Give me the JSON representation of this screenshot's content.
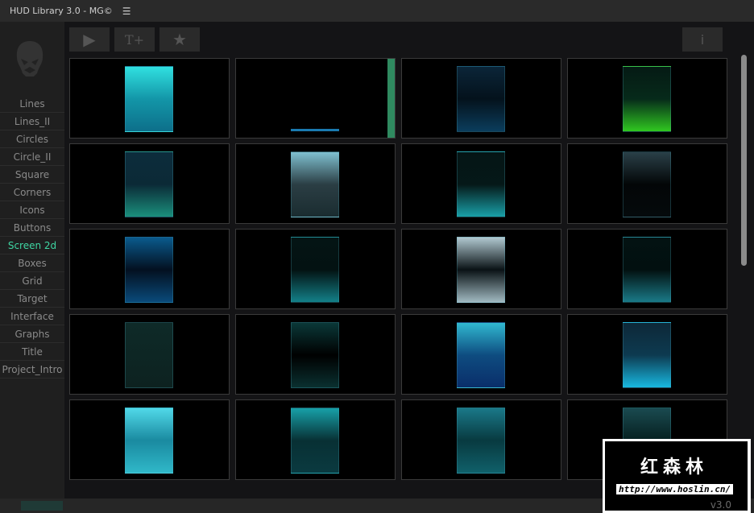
{
  "window": {
    "title": "HUD Library 3.0 - MG©",
    "menu_icon": "☰"
  },
  "sidebar": {
    "items": [
      "Lines",
      "Lines_II",
      "Circles",
      "Circle_II",
      "Square",
      "Corners",
      "Icons",
      "Buttons",
      "Screen 2d",
      "Boxes",
      "Grid",
      "Target",
      "Interface",
      "Graphs",
      "Title",
      "Project_Intro"
    ],
    "active": "Screen 2d",
    "active_color": "#3fd6a3"
  },
  "toolbar": {
    "play": "▶",
    "add_text": "T+",
    "favorite": "★",
    "info": "i"
  },
  "thumbnails": [
    {
      "top": "#30e0e0",
      "bottom": "#0d6f8a",
      "fill": "#1396a8"
    },
    {
      "top": "#000000",
      "bottom": "#000000",
      "fill": "#000000"
    },
    {
      "top": "#0b2538",
      "bottom": "#0b3d5c",
      "fill": "#04121c"
    },
    {
      "top": "#051a14",
      "bottom": "#30c820",
      "fill": "#062a1a"
    },
    {
      "top": "#0d2c3c",
      "bottom": "#1a8f7c",
      "fill": "#0b2a36"
    },
    {
      "top": "#7fc0d0",
      "bottom": "#1a2c30",
      "fill": "#2b3e44"
    },
    {
      "top": "#051515",
      "bottom": "#19a0a8",
      "fill": "#051818"
    },
    {
      "top": "#2a4048",
      "bottom": "#050a0c",
      "fill": "#030607"
    },
    {
      "top": "#0a5a8c",
      "bottom": "#0a4a7a",
      "fill": "#031020"
    },
    {
      "top": "#041414",
      "bottom": "#138088",
      "fill": "#031212"
    },
    {
      "top": "#b0c8d0",
      "bottom": "#a0b8c0",
      "fill": "#0a1215"
    },
    {
      "top": "#031212",
      "bottom": "#1a7a88",
      "fill": "#021010"
    },
    {
      "top": "#0f2a28",
      "bottom": "#0d2220",
      "fill": "#0d2624"
    },
    {
      "top": "#0a3838",
      "bottom": "#0a3030",
      "fill": "#000000"
    },
    {
      "top": "#30b8d0",
      "bottom": "#0a2e6a",
      "fill": "#0e4c80"
    },
    {
      "top": "#0d2838",
      "bottom": "#18b8e0",
      "fill": "#0d3a50"
    },
    {
      "top": "#50d8e8",
      "bottom": "#30b8c8",
      "fill": "#1a8aa0"
    },
    {
      "top": "#17a0a8",
      "bottom": "#0a3a40",
      "fill": "#083034"
    },
    {
      "top": "#1a7888",
      "bottom": "#10606a",
      "fill": "#083a40"
    },
    {
      "top": "#1a4a50",
      "bottom": "#0a3a3a",
      "fill": "#062020"
    }
  ],
  "status": {
    "version": "v3.0",
    "progress": 0.6
  },
  "watermark": {
    "text": "红森林",
    "url": "http://www.hoslin.cn/"
  }
}
